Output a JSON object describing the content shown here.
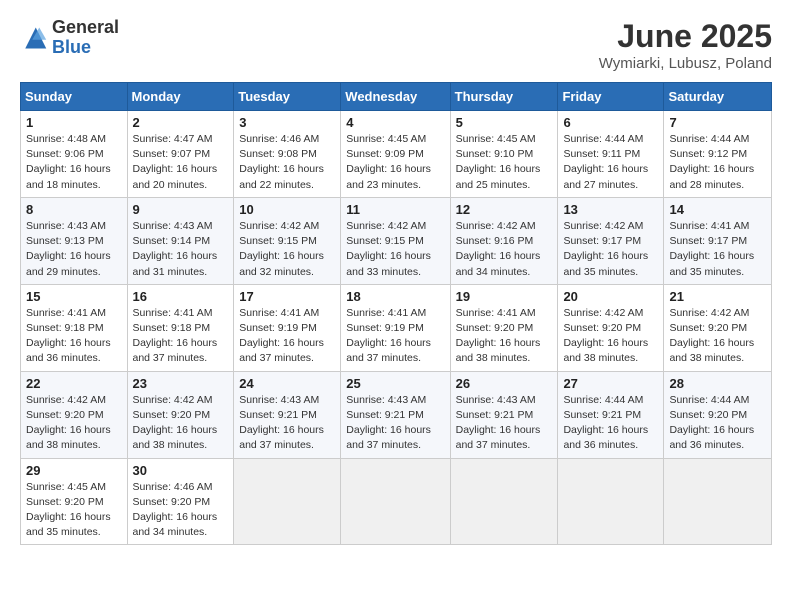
{
  "logo": {
    "general": "General",
    "blue": "Blue"
  },
  "title": {
    "month": "June 2025",
    "location": "Wymiarki, Lubusz, Poland"
  },
  "weekdays": [
    "Sunday",
    "Monday",
    "Tuesday",
    "Wednesday",
    "Thursday",
    "Friday",
    "Saturday"
  ],
  "weeks": [
    [
      {
        "day": "1",
        "lines": [
          "Sunrise: 4:48 AM",
          "Sunset: 9:06 PM",
          "Daylight: 16 hours",
          "and 18 minutes."
        ]
      },
      {
        "day": "2",
        "lines": [
          "Sunrise: 4:47 AM",
          "Sunset: 9:07 PM",
          "Daylight: 16 hours",
          "and 20 minutes."
        ]
      },
      {
        "day": "3",
        "lines": [
          "Sunrise: 4:46 AM",
          "Sunset: 9:08 PM",
          "Daylight: 16 hours",
          "and 22 minutes."
        ]
      },
      {
        "day": "4",
        "lines": [
          "Sunrise: 4:45 AM",
          "Sunset: 9:09 PM",
          "Daylight: 16 hours",
          "and 23 minutes."
        ]
      },
      {
        "day": "5",
        "lines": [
          "Sunrise: 4:45 AM",
          "Sunset: 9:10 PM",
          "Daylight: 16 hours",
          "and 25 minutes."
        ]
      },
      {
        "day": "6",
        "lines": [
          "Sunrise: 4:44 AM",
          "Sunset: 9:11 PM",
          "Daylight: 16 hours",
          "and 27 minutes."
        ]
      },
      {
        "day": "7",
        "lines": [
          "Sunrise: 4:44 AM",
          "Sunset: 9:12 PM",
          "Daylight: 16 hours",
          "and 28 minutes."
        ]
      }
    ],
    [
      {
        "day": "8",
        "lines": [
          "Sunrise: 4:43 AM",
          "Sunset: 9:13 PM",
          "Daylight: 16 hours",
          "and 29 minutes."
        ]
      },
      {
        "day": "9",
        "lines": [
          "Sunrise: 4:43 AM",
          "Sunset: 9:14 PM",
          "Daylight: 16 hours",
          "and 31 minutes."
        ]
      },
      {
        "day": "10",
        "lines": [
          "Sunrise: 4:42 AM",
          "Sunset: 9:15 PM",
          "Daylight: 16 hours",
          "and 32 minutes."
        ]
      },
      {
        "day": "11",
        "lines": [
          "Sunrise: 4:42 AM",
          "Sunset: 9:15 PM",
          "Daylight: 16 hours",
          "and 33 minutes."
        ]
      },
      {
        "day": "12",
        "lines": [
          "Sunrise: 4:42 AM",
          "Sunset: 9:16 PM",
          "Daylight: 16 hours",
          "and 34 minutes."
        ]
      },
      {
        "day": "13",
        "lines": [
          "Sunrise: 4:42 AM",
          "Sunset: 9:17 PM",
          "Daylight: 16 hours",
          "and 35 minutes."
        ]
      },
      {
        "day": "14",
        "lines": [
          "Sunrise: 4:41 AM",
          "Sunset: 9:17 PM",
          "Daylight: 16 hours",
          "and 35 minutes."
        ]
      }
    ],
    [
      {
        "day": "15",
        "lines": [
          "Sunrise: 4:41 AM",
          "Sunset: 9:18 PM",
          "Daylight: 16 hours",
          "and 36 minutes."
        ]
      },
      {
        "day": "16",
        "lines": [
          "Sunrise: 4:41 AM",
          "Sunset: 9:18 PM",
          "Daylight: 16 hours",
          "and 37 minutes."
        ]
      },
      {
        "day": "17",
        "lines": [
          "Sunrise: 4:41 AM",
          "Sunset: 9:19 PM",
          "Daylight: 16 hours",
          "and 37 minutes."
        ]
      },
      {
        "day": "18",
        "lines": [
          "Sunrise: 4:41 AM",
          "Sunset: 9:19 PM",
          "Daylight: 16 hours",
          "and 37 minutes."
        ]
      },
      {
        "day": "19",
        "lines": [
          "Sunrise: 4:41 AM",
          "Sunset: 9:20 PM",
          "Daylight: 16 hours",
          "and 38 minutes."
        ]
      },
      {
        "day": "20",
        "lines": [
          "Sunrise: 4:42 AM",
          "Sunset: 9:20 PM",
          "Daylight: 16 hours",
          "and 38 minutes."
        ]
      },
      {
        "day": "21",
        "lines": [
          "Sunrise: 4:42 AM",
          "Sunset: 9:20 PM",
          "Daylight: 16 hours",
          "and 38 minutes."
        ]
      }
    ],
    [
      {
        "day": "22",
        "lines": [
          "Sunrise: 4:42 AM",
          "Sunset: 9:20 PM",
          "Daylight: 16 hours",
          "and 38 minutes."
        ]
      },
      {
        "day": "23",
        "lines": [
          "Sunrise: 4:42 AM",
          "Sunset: 9:20 PM",
          "Daylight: 16 hours",
          "and 38 minutes."
        ]
      },
      {
        "day": "24",
        "lines": [
          "Sunrise: 4:43 AM",
          "Sunset: 9:21 PM",
          "Daylight: 16 hours",
          "and 37 minutes."
        ]
      },
      {
        "day": "25",
        "lines": [
          "Sunrise: 4:43 AM",
          "Sunset: 9:21 PM",
          "Daylight: 16 hours",
          "and 37 minutes."
        ]
      },
      {
        "day": "26",
        "lines": [
          "Sunrise: 4:43 AM",
          "Sunset: 9:21 PM",
          "Daylight: 16 hours",
          "and 37 minutes."
        ]
      },
      {
        "day": "27",
        "lines": [
          "Sunrise: 4:44 AM",
          "Sunset: 9:21 PM",
          "Daylight: 16 hours",
          "and 36 minutes."
        ]
      },
      {
        "day": "28",
        "lines": [
          "Sunrise: 4:44 AM",
          "Sunset: 9:20 PM",
          "Daylight: 16 hours",
          "and 36 minutes."
        ]
      }
    ],
    [
      {
        "day": "29",
        "lines": [
          "Sunrise: 4:45 AM",
          "Sunset: 9:20 PM",
          "Daylight: 16 hours",
          "and 35 minutes."
        ]
      },
      {
        "day": "30",
        "lines": [
          "Sunrise: 4:46 AM",
          "Sunset: 9:20 PM",
          "Daylight: 16 hours",
          "and 34 minutes."
        ]
      },
      null,
      null,
      null,
      null,
      null
    ]
  ]
}
